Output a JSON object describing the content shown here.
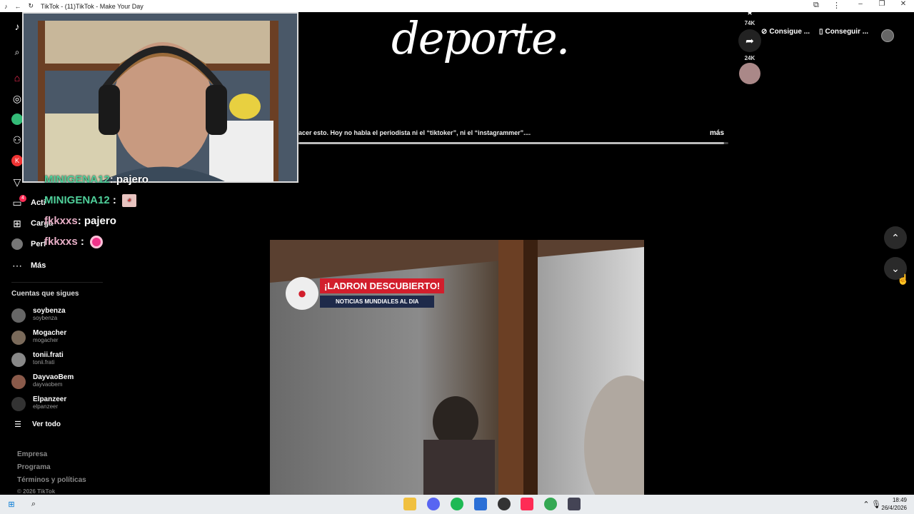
{
  "browser": {
    "title": "TikTok - (11)TikTok - Make Your Day"
  },
  "sidebar": {
    "items": [
      {
        "label": "Actividad",
        "visible": "Acti",
        "icon": "inbox-icon",
        "badge": "4"
      },
      {
        "label": "Cargar",
        "visible": "Carga",
        "icon": "upload-icon"
      },
      {
        "label": "Perfil",
        "visible": "Perf",
        "icon": "profile-icon"
      },
      {
        "label": "Más",
        "visible": "Más",
        "icon": "more-icon"
      }
    ],
    "following_title": "Cuentas que sigues",
    "following": [
      {
        "name": "soybenza",
        "handle": "soybenza"
      },
      {
        "name": "Mogacher",
        "handle": "mogacher"
      },
      {
        "name": "tonii.frati",
        "handle": "tonii.frati"
      },
      {
        "name": "DayvaoBem",
        "handle": "dayvaobem"
      },
      {
        "name": "Elpanzeer",
        "handle": "elpanzeer"
      }
    ],
    "see_all": "Ver todo",
    "footer": [
      "Empresa",
      "Programa",
      "Términos y políticas",
      "© 2026 TikTok"
    ]
  },
  "chat": [
    {
      "user": "MINIGENA12",
      "msg": ": pajero",
      "color": "#4fcf9a"
    },
    {
      "user": "MINIGENA12",
      "msg": ":",
      "emote": "anime-emote",
      "color": "#4fcf9a"
    },
    {
      "user": "fkkxxs",
      "msg": ": pajero",
      "color": "#e9b0c8"
    },
    {
      "user": "fkkxxs",
      "msg": ":",
      "emote": "pink-circle-emote",
      "color": "#e9b0c8"
    }
  ],
  "video1": {
    "title_text": "deporte.",
    "caption": "acer esto. Hoy no habla el periodista ni el “tiktoker”, ni el “instagrammer”....",
    "more": "más",
    "progress": 0.99
  },
  "actions": {
    "likes": "74K",
    "shares": "24K"
  },
  "top_buttons": {
    "coins": "Consigue ...",
    "app": "Conseguir ..."
  },
  "video2": {
    "badge_title": "¡LADRON DESCUBIERTO!",
    "badge_sub": "NOTICIAS MUNDIALES AL DIA"
  },
  "taskbar": {
    "time": "18:49",
    "date": "26/4/2026"
  }
}
